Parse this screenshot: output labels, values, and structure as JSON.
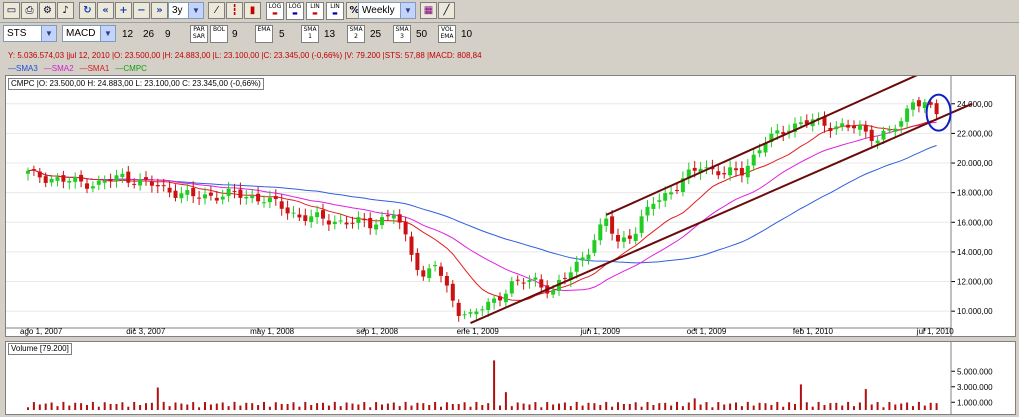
{
  "toolbar": {
    "period_value": "3y",
    "frequency_value": "Weekly"
  },
  "indicators": {
    "symbol_value": "STS",
    "study_value": "MACD",
    "macd_fast": "12",
    "macd_slow": "26",
    "macd_signal": "9",
    "par_sar_label": "PAR\nSAR",
    "bol_label": "BOL",
    "bol_value": "9",
    "ema_label": "EMA",
    "ema_value": "5",
    "sma1_label": "SMA\n1",
    "sma1_value": "13",
    "sma2_label": "SMA\n2",
    "sma2_value": "25",
    "sma3_label": "SMA\n3",
    "sma3_value": "50",
    "vol_ema_label": "VOL\nEMA",
    "vol_ema_value": "10"
  },
  "status_line": "Y: 5.036.574,03 |jul 12, 2010 |O: 23.500,00 |H: 24.883,00 |L: 23.100,00 |C: 23.345,00 (-0,66%) |V: 79.200 |STS: 57,88 |MACD: 808,84",
  "legend": [
    {
      "label": "—SMA3",
      "color": "#2050d0"
    },
    {
      "label": "—SMA2",
      "color": "#d020d0"
    },
    {
      "label": "—SMA1",
      "color": "#d02020"
    },
    {
      "label": "—CMPC",
      "color": "#10a010"
    }
  ],
  "price_label": "CMPC |O: 23.500,00  H: 24.883,00  L: 23.100,00  C: 23.345,00 (-0,66%)",
  "volume_label": "Volume [79.200]",
  "colors": {
    "up": "#22cc22",
    "down": "#cc1111",
    "sma1": "#e02020",
    "sma2": "#e020e0",
    "sma3": "#3060e0",
    "trend": "#6a0a0a",
    "volume": "#b01010",
    "ellipse": "#1020c0"
  },
  "chart_data": {
    "type": "line",
    "title": "",
    "xlabel": "",
    "ylabel": "",
    "x_ticks": [
      "ago 1, 2007",
      "dic 3, 2007",
      "may 1, 2008",
      "sep 1, 2008",
      "ene 1, 2009",
      "jun 1, 2009",
      "oct 1, 2009",
      "feb 1, 2010",
      "jul 1, 2010"
    ],
    "x_tick_index": [
      0,
      18,
      39,
      57,
      74,
      95,
      113,
      131,
      152
    ],
    "y_ticks": [
      "10.000,00",
      "12.000,00",
      "14.000,00",
      "16.000,00",
      "18.000,00",
      "20.000,00",
      "22.000,00",
      "24.000,00"
    ],
    "y_tick_values": [
      10000,
      12000,
      14000,
      16000,
      18000,
      20000,
      22000,
      24000
    ],
    "ylim": [
      9000,
      25200
    ],
    "volume_ticks": [
      "1.000.000",
      "3.000.000",
      "5.000.000"
    ],
    "volume_tick_values": [
      1000000,
      3000000,
      5000000
    ],
    "volume_ylim": [
      0,
      8000000
    ],
    "anchors_close": [
      [
        0,
        19300
      ],
      [
        6,
        18800
      ],
      [
        12,
        18600
      ],
      [
        16,
        19100
      ],
      [
        22,
        18400
      ],
      [
        28,
        17700
      ],
      [
        34,
        17900
      ],
      [
        40,
        17600
      ],
      [
        46,
        16400
      ],
      [
        52,
        16100
      ],
      [
        58,
        15900
      ],
      [
        62,
        16600
      ],
      [
        65,
        14000
      ],
      [
        67,
        12300
      ],
      [
        69,
        13200
      ],
      [
        71,
        11400
      ],
      [
        73,
        10100
      ],
      [
        75,
        9700
      ],
      [
        78,
        10400
      ],
      [
        82,
        11800
      ],
      [
        86,
        12100
      ],
      [
        89,
        11300
      ],
      [
        92,
        12700
      ],
      [
        95,
        14200
      ],
      [
        98,
        16100
      ],
      [
        100,
        14700
      ],
      [
        103,
        15400
      ],
      [
        106,
        17400
      ],
      [
        110,
        18400
      ],
      [
        114,
        19900
      ],
      [
        118,
        19200
      ],
      [
        121,
        19500
      ],
      [
        125,
        21400
      ],
      [
        129,
        22500
      ],
      [
        133,
        22800
      ],
      [
        137,
        22500
      ],
      [
        141,
        22300
      ],
      [
        144,
        21700
      ],
      [
        146,
        22100
      ],
      [
        148,
        22700
      ],
      [
        150,
        24400
      ],
      [
        152,
        23900
      ],
      [
        154,
        23350
      ]
    ],
    "volume_spikes": [
      [
        22,
        2900000
      ],
      [
        79,
        6400000
      ],
      [
        81,
        2300000
      ],
      [
        113,
        1500000
      ],
      [
        131,
        3300000
      ],
      [
        142,
        2700000
      ]
    ],
    "trend_upper": [
      [
        98,
        16500
      ],
      [
        160,
        27600
      ]
    ],
    "trend_lower": [
      [
        75,
        9200
      ],
      [
        160,
        24000
      ]
    ],
    "highlight_ellipse_center": [
      154,
      23400
    ]
  }
}
